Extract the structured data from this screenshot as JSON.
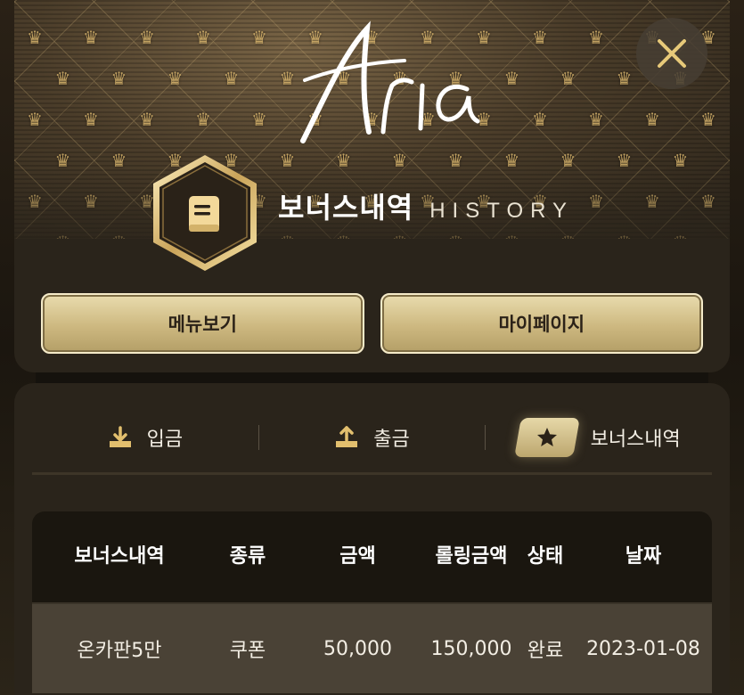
{
  "brand": {
    "logo_text": "Aria"
  },
  "header": {
    "title": "보너스내역",
    "subtitle": "HISTORY",
    "close_icon": "close-icon",
    "badge_icon": "book-icon"
  },
  "nav": {
    "menu_label": "메뉴보기",
    "mypage_label": "마이페이지"
  },
  "tabs": [
    {
      "label": "입금",
      "icon": "download-icon",
      "active": false
    },
    {
      "label": "출금",
      "icon": "upload-icon",
      "active": false
    },
    {
      "label": "보너스내역",
      "icon": "star-icon",
      "active": true
    }
  ],
  "table": {
    "columns": [
      "보너스내역",
      "종류",
      "금액",
      "롤링금액",
      "상태",
      "날짜"
    ],
    "rows": [
      [
        "온카판5만",
        "쿠폰",
        "50,000",
        "150,000",
        "완료",
        "2023-01-08"
      ]
    ]
  },
  "colors": {
    "gold": "#cdb880",
    "panel": "#2a241b",
    "header_row": "#1a160f",
    "data_row": "#4a4236"
  }
}
